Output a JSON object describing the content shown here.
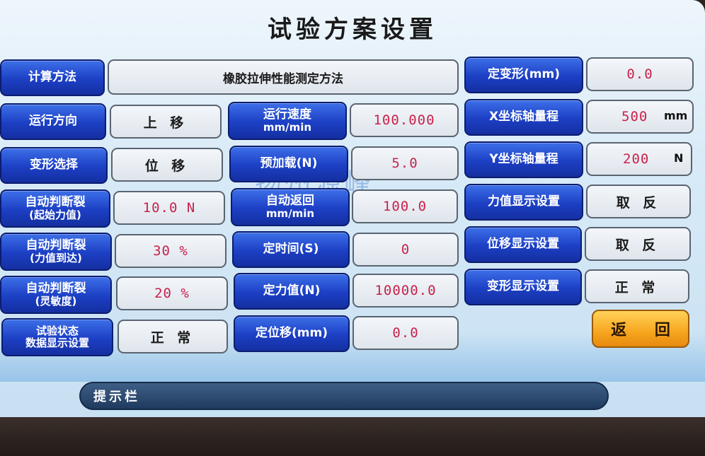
{
  "title": "试验方案设置",
  "watermark": "扬州源峰",
  "left": {
    "calc_method_label": "计算方法",
    "calc_method_value": "橡胶拉伸性能测定方法",
    "direction_label": "运行方向",
    "direction_value": "上 移",
    "deform_select_label": "变形选择",
    "deform_select_value": "位 移",
    "auto_break_start_line1": "自动判断裂",
    "auto_break_start_line2": "(起始力值)",
    "auto_break_start_value": "10.0 N",
    "auto_break_reach_line1": "自动判断裂",
    "auto_break_reach_line2": "(力值到达)",
    "auto_break_reach_value": "30 %",
    "auto_break_sens_line1": "自动判断裂",
    "auto_break_sens_line2": "(灵敏度)",
    "auto_break_sens_value": "20 %",
    "status_display_line1": "试验状态",
    "status_display_line2": "数据显示设置",
    "status_display_value": "正 常"
  },
  "middle": {
    "speed_line1": "运行速度",
    "speed_line2": "mm/min",
    "speed_value": "100.000",
    "preload_label": "预加载(N)",
    "preload_value": "5.0",
    "auto_return_line1": "自动返回",
    "auto_return_line2": "mm/min",
    "auto_return_value": "100.0",
    "fixed_time_label": "定时间(S)",
    "fixed_time_value": "0",
    "fixed_force_label": "定力值(N)",
    "fixed_force_value": "10000.0",
    "fixed_disp_label": "定位移(mm)",
    "fixed_disp_value": "0.0"
  },
  "right": {
    "fixed_deform_label": "定变形(mm)",
    "fixed_deform_value": "0.0",
    "x_range_label": "X坐标轴量程",
    "x_range_value": "500",
    "x_range_unit": "mm",
    "y_range_label": "Y坐标轴量程",
    "y_range_value": "200",
    "y_range_unit": "N",
    "force_display_label": "力值显示设置",
    "force_display_value": "取 反",
    "disp_display_label": "位移显示设置",
    "disp_display_value": "取 反",
    "deform_display_label": "变形显示设置",
    "deform_display_value": "正 常"
  },
  "back_button": "返 回",
  "hint_bar": "提示栏"
}
